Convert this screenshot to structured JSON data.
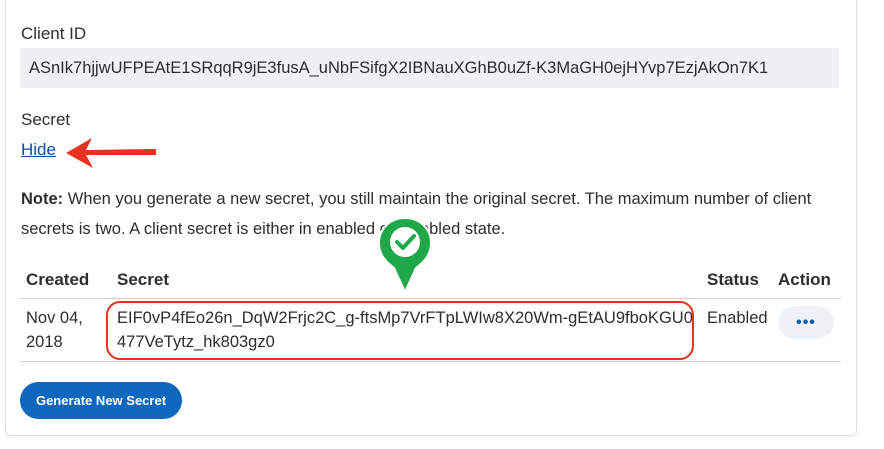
{
  "client": {
    "label": "Client ID",
    "value": "ASnIk7hjjwUFPEAtE1SRqqR9jE3fusA_uNbFSifgX2IBNauXGhB0uZf-K3MaGH0ejHYvp7EzjAkOn7K1"
  },
  "secret": {
    "label": "Secret",
    "hide_link": "Hide"
  },
  "note": {
    "prefix": "Note:",
    "text": " When you generate a new secret, you still maintain the original secret. The maximum number of client secrets is two. A client secret is either in enabled or disabled state."
  },
  "table": {
    "headers": {
      "created": "Created",
      "secret": "Secret",
      "status": "Status",
      "action": "Action"
    },
    "rows": [
      {
        "created": "Nov 04, 2018",
        "secret": "EIF0vP4fEo26n_DqW2Frjc2C_g-ftsMp7VrFTpLWIw8X20Wm-gEtAU9fboKGU0477VeTytz_hk803gz0",
        "status": "Enabled",
        "action_icon": "more-dots-icon"
      }
    ]
  },
  "buttons": {
    "generate": "Generate New Secret"
  },
  "annotations": {
    "arrow_color": "#e8321f",
    "highlight_color": "#e8321f",
    "check_pin_color": "#1fa84a",
    "check_icon": "checkmark-icon"
  }
}
